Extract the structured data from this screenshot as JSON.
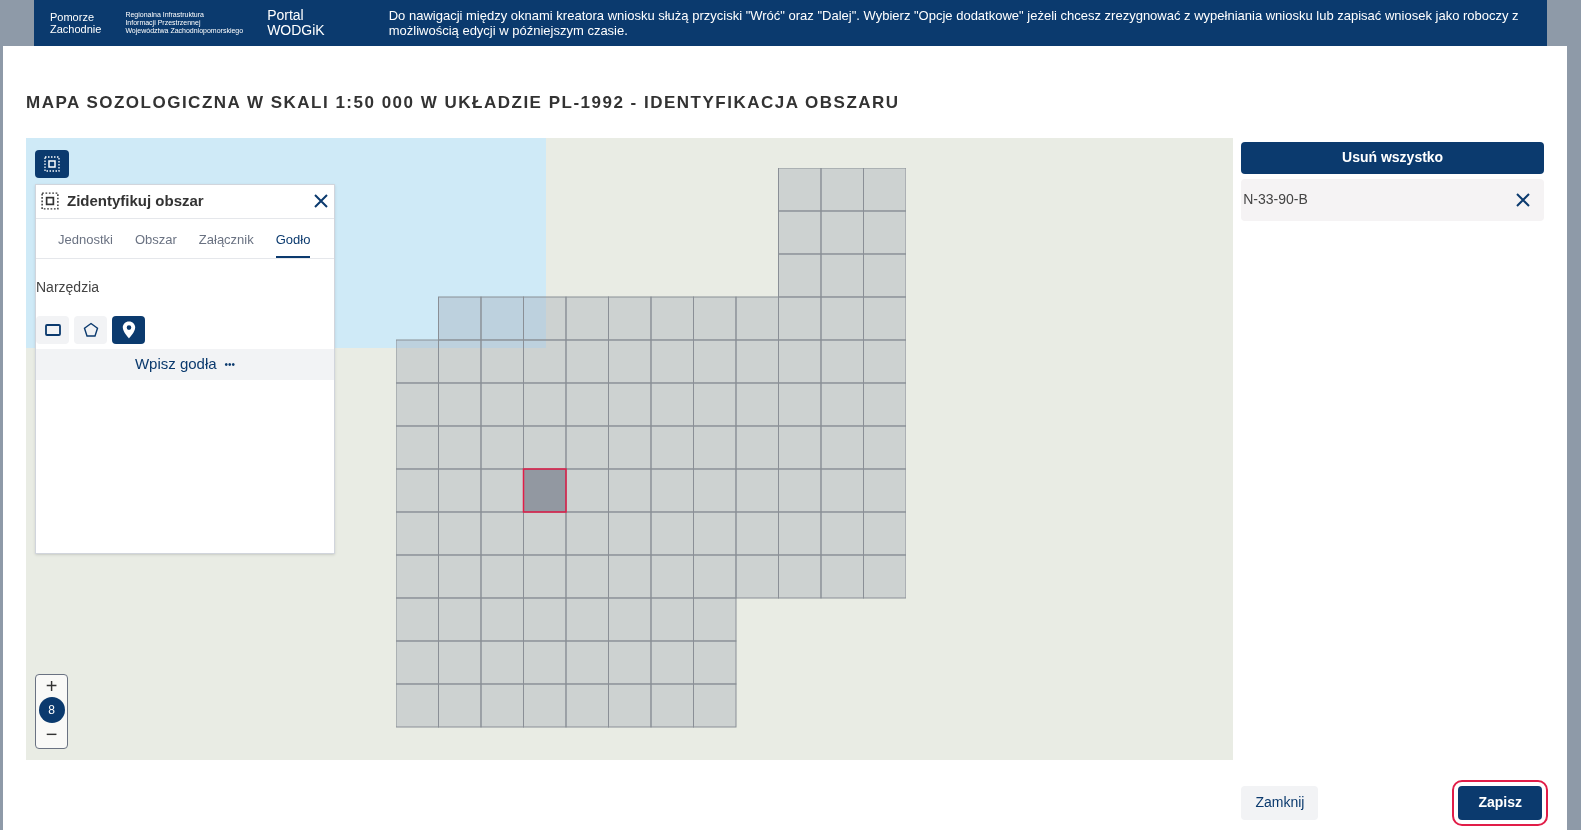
{
  "banner": {
    "logo_1": [
      "Pomorze",
      "Zachodnie"
    ],
    "logo_2": [
      "Regionalna Infrastruktura",
      "Informacji Przestrzennej",
      "Województwa Zachodniopomorskiego"
    ],
    "portal": [
      "Portal",
      "WODGiK"
    ],
    "notice": "Do nawigacji między oknami kreatora wniosku służą przyciski \"Wróć\" oraz \"Dalej\". Wybierz \"Opcje dodatkowe\" jeżeli chcesz zrezygnować z wypełniania wniosku lub zapisać wniosek jako roboczy z możliwością edycji w późniejszym czasie."
  },
  "dialog": {
    "title": "MAPA SOZOLOGICZNA W SKALI 1:50 000 W UKŁADZIE PL-1992 - IDENTYFIKACJA OBSZARU"
  },
  "panel": {
    "title": "Zidentyfikuj obszar",
    "tabs": [
      {
        "label": "Jednostki",
        "selected": false
      },
      {
        "label": "Obszar",
        "selected": false
      },
      {
        "label": "Załącznik",
        "selected": false
      },
      {
        "label": "Godło",
        "selected": true
      }
    ],
    "section": "Narzędzia",
    "tools": [
      {
        "kind": "rectangle",
        "selected": false
      },
      {
        "kind": "polygon",
        "selected": false
      },
      {
        "kind": "point",
        "selected": true
      }
    ],
    "action": "Wpisz godła",
    "action_more": "•••"
  },
  "zoom": {
    "plus": "+",
    "level": "8",
    "minus": "−"
  },
  "selection": {
    "clear_button": "Usuń wszystko",
    "items": [
      {
        "label": "N-33-90-B"
      }
    ]
  },
  "footer": {
    "buttons": [
      {
        "label": "Zamknij",
        "kind": "secondary"
      },
      {
        "label": "Zapisz",
        "kind": "primary"
      }
    ]
  }
}
